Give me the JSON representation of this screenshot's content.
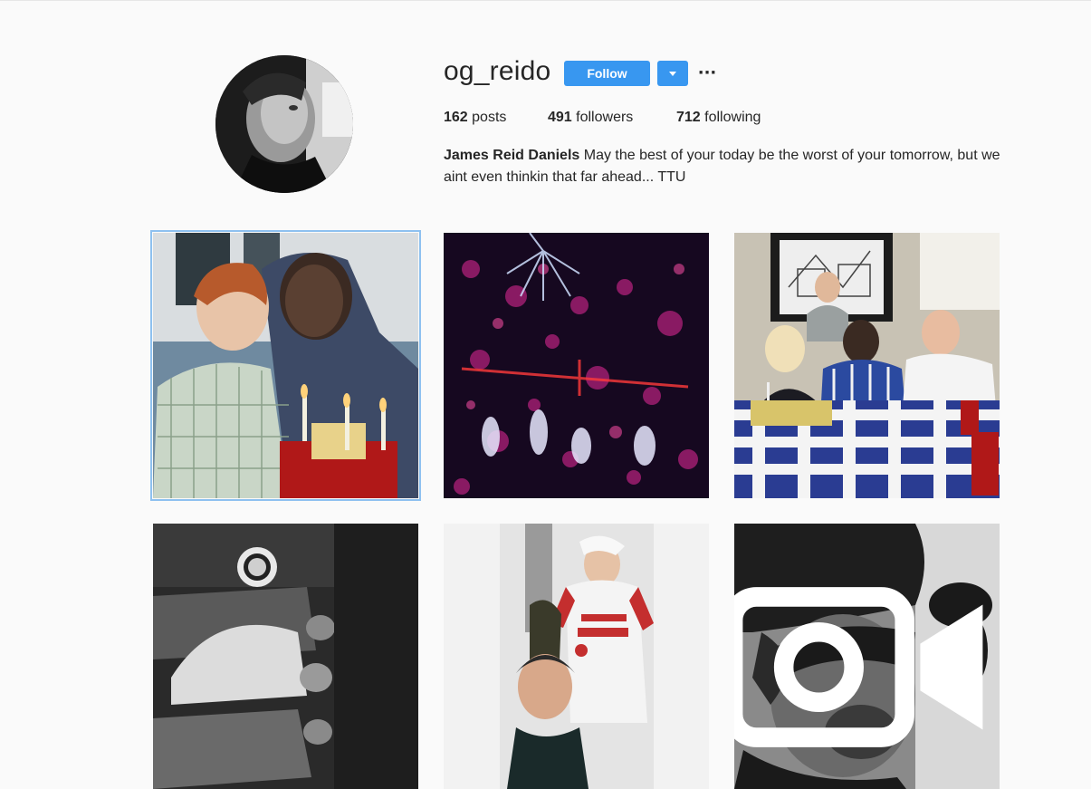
{
  "profile": {
    "username": "og_reido",
    "follow_label": "Follow",
    "posts_count": "162",
    "posts_label": "posts",
    "followers_count": "491",
    "followers_label": "followers",
    "following_count": "712",
    "following_label": "following",
    "full_name": "James Reid Daniels",
    "bio": "May the best of your today be the worst of your tomorrow, but we aint even thinkin that far ahead... TTU"
  },
  "icons": {
    "more": "more-options-icon",
    "dropdown": "chevron-down-icon",
    "video": "video-camera-icon"
  },
  "colors": {
    "accent": "#3897f0",
    "background": "#fafafa",
    "text": "#262626"
  },
  "posts": [
    {
      "subject": "birthday-boy-photo",
      "is_video": false
    },
    {
      "subject": "fireworks-photo",
      "is_video": false
    },
    {
      "subject": "family-birthday-table-photo",
      "is_video": false
    },
    {
      "subject": "bw-group-photo",
      "is_video": false
    },
    {
      "subject": "selfie-photo",
      "is_video": false
    },
    {
      "subject": "bw-portrait-video",
      "is_video": true
    }
  ]
}
